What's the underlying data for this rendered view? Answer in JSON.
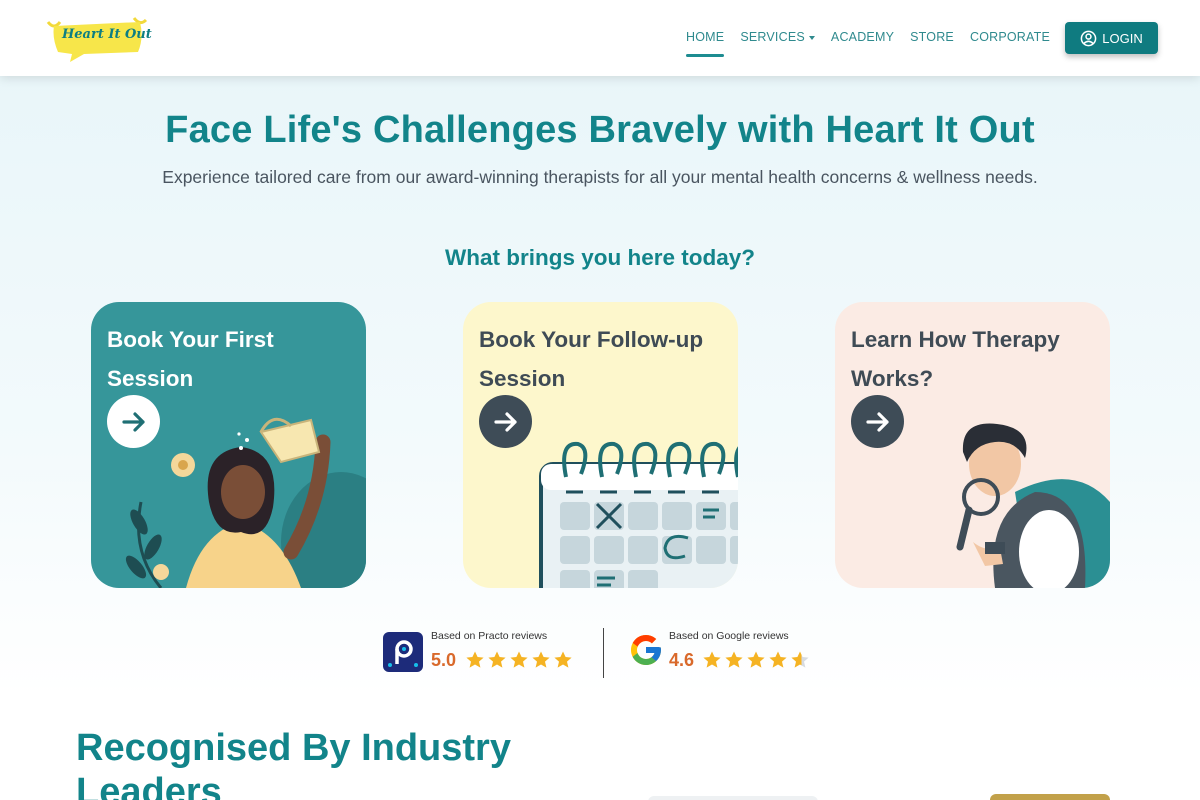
{
  "brand": {
    "logo_text": "Heart It Out"
  },
  "nav": {
    "items": [
      {
        "label": "HOME",
        "active": true
      },
      {
        "label": "SERVICES",
        "dropdown": true
      },
      {
        "label": "ACADEMY"
      },
      {
        "label": "STORE"
      },
      {
        "label": "CORPORATE"
      }
    ],
    "login_label": "LOGIN"
  },
  "hero": {
    "title": "Face Life's Challenges Bravely with Heart It Out",
    "subtitle": "Experience tailored care from our award-winning therapists for all your mental health concerns & wellness needs.",
    "question": "What brings you here today?"
  },
  "cards": [
    {
      "title_line1": "Book Your First",
      "title_line2": "Session",
      "bg": "#36969a",
      "text_color": "#ffffff"
    },
    {
      "title_line1": "Book Your Follow-up",
      "title_line2": "Session",
      "bg": "#fdf7cc",
      "text_color": "#3f4b55"
    },
    {
      "title_line1": "Learn How Therapy",
      "title_line2": "Works?",
      "bg": "#fbebe4",
      "text_color": "#3f4b55"
    }
  ],
  "reviews": [
    {
      "caption": "Based on Practo reviews",
      "score": "5.0",
      "rating": 5.0,
      "icon": "practo-icon"
    },
    {
      "caption": "Based on Google reviews",
      "score": "4.6",
      "rating": 4.6,
      "icon": "google-icon"
    }
  ],
  "recognised": {
    "line1": "Recognised By Industry",
    "line2": "Leaders"
  },
  "colors": {
    "brand": "#12848a",
    "login_bg": "#0f7b80",
    "star": "#f5b323",
    "score": "#d9692b"
  }
}
